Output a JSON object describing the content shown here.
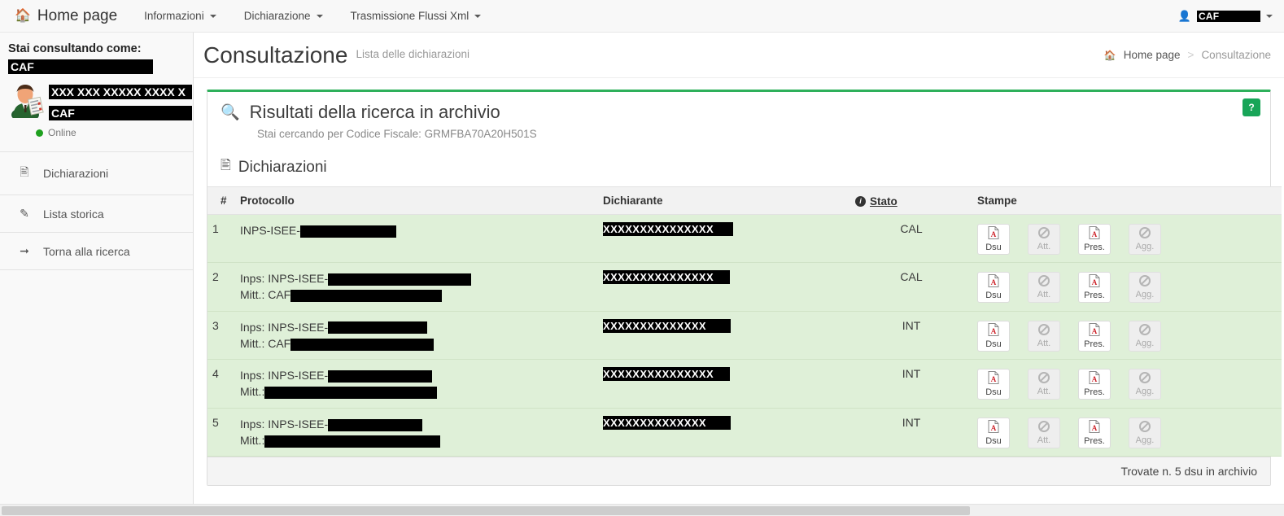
{
  "navbar": {
    "brand": {
      "label": "Home page",
      "icon": "home-icon"
    },
    "items": [
      {
        "label": "Informazioni",
        "has_caret": true
      },
      {
        "label": "Dichiarazione",
        "has_caret": true
      },
      {
        "label": "Trasmissione Flussi Xml",
        "has_caret": true
      }
    ],
    "user": {
      "icon": "user-icon",
      "label": "CAF",
      "has_caret": true
    }
  },
  "sidebar": {
    "heading": "Stai consultando come:",
    "org_redacted": "CAF",
    "user_name_redacted": "XXX XXX XXXXX XXXX X",
    "user_role_redacted": "CAF",
    "status": "Online",
    "status_color": "#1fa01f",
    "items": [
      {
        "label": "Dichiarazioni",
        "icon": "document-icon"
      },
      {
        "label": "Lista storica",
        "icon": "edit-icon"
      },
      {
        "label": "Torna alla ricerca",
        "icon": "sign-out-icon"
      }
    ]
  },
  "page": {
    "title": "Consultazione",
    "subtitle": "Lista delle dichiarazioni",
    "breadcrumb": {
      "home_icon": "home-icon",
      "home": "Home page",
      "separator": ">",
      "current": "Consultazione"
    }
  },
  "panel": {
    "accent_color": "#2eb05b",
    "search_icon": "magnifier-icon",
    "title": "Risultati della ricerca in archivio",
    "subtitle": "Stai cercando per Codice Fiscale: GRMFBA70A20H501S",
    "help_label": "?",
    "section": {
      "icon": "document-icon",
      "title": "Dichiarazioni"
    },
    "footer": "Trovate n. 5 dsu in archivio"
  },
  "table": {
    "columns": {
      "num": "#",
      "protocollo": "Protocollo",
      "dichiarante": "Dichiarante",
      "stato": "Stato",
      "stato_icon": "info-icon",
      "stampe": "Stampe"
    },
    "row_color": "#dff0d8",
    "rows": [
      {
        "num": "1",
        "prot_line1_prefix": "INPS-ISEE-",
        "prot_line1_bar_width": 118,
        "prot_line2_prefix": "",
        "prot_line2_bar_width": 0,
        "dichiarante_redacted": "XXXXXXXXXXXXXXX",
        "stato": "CAL",
        "actions": [
          {
            "label": "Dsu",
            "icon": "pdf-icon",
            "enabled": true
          },
          {
            "label": "Att.",
            "icon": "ban-icon",
            "enabled": false
          },
          {
            "label": "Pres.",
            "icon": "pdf-icon",
            "enabled": true
          },
          {
            "label": "Agg.",
            "icon": "ban-icon",
            "enabled": false
          }
        ]
      },
      {
        "num": "2",
        "prot_line1_prefix": "Inps: INPS-ISEE-",
        "prot_line1_bar_width": 176,
        "prot_line2_prefix": "Mitt.: CAF",
        "prot_line2_bar_width": 186,
        "dichiarante_redacted": "XXXXXXXXXXXXXXX",
        "stato": "CAL",
        "actions": [
          {
            "label": "Dsu",
            "icon": "pdf-icon",
            "enabled": true
          },
          {
            "label": "Att.",
            "icon": "ban-icon",
            "enabled": false
          },
          {
            "label": "Pres.",
            "icon": "pdf-icon",
            "enabled": true
          },
          {
            "label": "Agg.",
            "icon": "ban-icon",
            "enabled": false
          }
        ]
      },
      {
        "num": "3",
        "prot_line1_prefix": "Inps: INPS-ISEE-",
        "prot_line1_bar_width": 122,
        "prot_line2_prefix": "Mitt.: CAF",
        "prot_line2_bar_width": 176,
        "dichiarante_redacted": "XXXXXXXXXXXXXX",
        "stato": "INT",
        "actions": [
          {
            "label": "Dsu",
            "icon": "pdf-icon",
            "enabled": true
          },
          {
            "label": "Att.",
            "icon": "ban-icon",
            "enabled": false
          },
          {
            "label": "Pres.",
            "icon": "pdf-icon",
            "enabled": true
          },
          {
            "label": "Agg.",
            "icon": "ban-icon",
            "enabled": false
          }
        ]
      },
      {
        "num": "4",
        "prot_line1_prefix": "Inps: INPS-ISEE-",
        "prot_line1_bar_width": 128,
        "prot_line2_prefix": "Mitt.:",
        "prot_line2_bar_width": 212,
        "dichiarante_redacted": "XXXXXXXXXXXXXXX",
        "stato": "INT",
        "actions": [
          {
            "label": "Dsu",
            "icon": "pdf-icon",
            "enabled": true
          },
          {
            "label": "Att.",
            "icon": "ban-icon",
            "enabled": false
          },
          {
            "label": "Pres.",
            "icon": "pdf-icon",
            "enabled": true
          },
          {
            "label": "Agg.",
            "icon": "ban-icon",
            "enabled": false
          }
        ]
      },
      {
        "num": "5",
        "prot_line1_prefix": "Inps: INPS-ISEE-",
        "prot_line1_bar_width": 116,
        "prot_line2_prefix": "Mitt.:",
        "prot_line2_bar_width": 216,
        "dichiarante_redacted": "XXXXXXXXXXXXXX",
        "stato": "INT",
        "actions": [
          {
            "label": "Dsu",
            "icon": "pdf-icon",
            "enabled": true
          },
          {
            "label": "Att.",
            "icon": "ban-icon",
            "enabled": false
          },
          {
            "label": "Pres.",
            "icon": "pdf-icon",
            "enabled": true
          },
          {
            "label": "Agg.",
            "icon": "ban-icon",
            "enabled": false
          }
        ]
      }
    ]
  }
}
